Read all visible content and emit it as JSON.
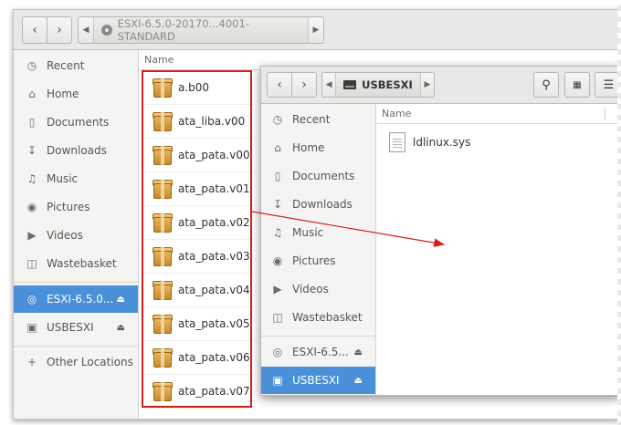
{
  "back_window": {
    "path": [
      "ESXI-6.5.0-20170...4001-STANDARD"
    ],
    "column_header": "Name",
    "sidebar": [
      {
        "label": "Recent",
        "icon": "clock-icon"
      },
      {
        "label": "Home",
        "icon": "home-icon"
      },
      {
        "label": "Documents",
        "icon": "document-icon"
      },
      {
        "label": "Downloads",
        "icon": "download-icon"
      },
      {
        "label": "Music",
        "icon": "music-icon"
      },
      {
        "label": "Pictures",
        "icon": "camera-icon"
      },
      {
        "label": "Videos",
        "icon": "video-icon"
      },
      {
        "label": "Wastebasket",
        "icon": "trash-icon"
      },
      {
        "label": "ESXI-6.5.0...",
        "icon": "disc-icon",
        "eject": true,
        "selected": true
      },
      {
        "label": "USBESXI",
        "icon": "drive-icon",
        "eject": true
      },
      {
        "label": "Other Locations",
        "icon": "plus-icon"
      }
    ],
    "files": [
      "a.b00",
      "ata_liba.v00",
      "ata_pata.v00",
      "ata_pata.v01",
      "ata_pata.v02",
      "ata_pata.v03",
      "ata_pata.v04",
      "ata_pata.v05",
      "ata_pata.v06",
      "ata_pata.v07"
    ]
  },
  "front_window": {
    "path": [
      "USBESXI"
    ],
    "column_header": "Name",
    "sidebar": [
      {
        "label": "Recent",
        "icon": "clock-icon"
      },
      {
        "label": "Home",
        "icon": "home-icon"
      },
      {
        "label": "Documents",
        "icon": "document-icon"
      },
      {
        "label": "Downloads",
        "icon": "download-icon"
      },
      {
        "label": "Music",
        "icon": "music-icon"
      },
      {
        "label": "Pictures",
        "icon": "camera-icon"
      },
      {
        "label": "Videos",
        "icon": "video-icon"
      },
      {
        "label": "Wastebasket",
        "icon": "trash-icon"
      },
      {
        "label": "ESXI-6.5...",
        "icon": "disc-icon",
        "eject": true
      },
      {
        "label": "USBESXI",
        "icon": "drive-icon",
        "eject": true,
        "selected": true
      }
    ],
    "files": [
      "ldlinux.sys"
    ]
  },
  "colors": {
    "selection_blue": "#4a90d9",
    "annotation_red": "#d0201e"
  }
}
